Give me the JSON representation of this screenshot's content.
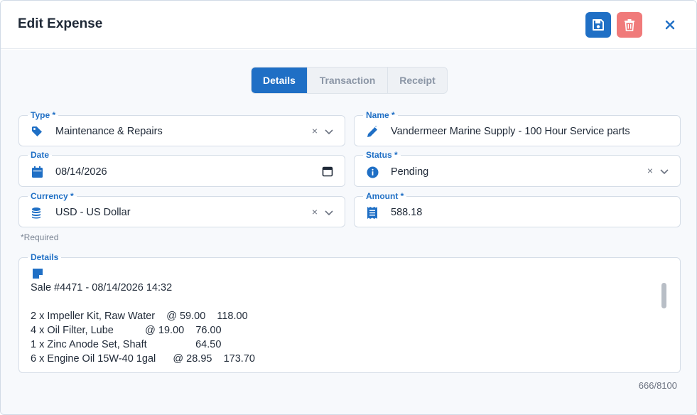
{
  "dialog": {
    "title": "Edit Expense"
  },
  "tabs": [
    {
      "label": "Details",
      "active": true
    },
    {
      "label": "Transaction",
      "active": false
    },
    {
      "label": "Receipt",
      "active": false
    }
  ],
  "fields": {
    "type": {
      "label": "Type *",
      "value": "Maintenance & Repairs",
      "icon": "tag-icon"
    },
    "name": {
      "label": "Name *",
      "value": "Vandermeer Marine Supply - 100 Hour Service parts",
      "icon": "pencil-icon"
    },
    "date": {
      "label": "Date",
      "value": "08/14/2026",
      "icon": "calendar-icon"
    },
    "status": {
      "label": "Status *",
      "value": "Pending",
      "icon": "info-icon"
    },
    "currency": {
      "label": "Currency *",
      "value": "USD - US Dollar",
      "icon": "coins-icon"
    },
    "amount": {
      "label": "Amount *",
      "value": "588.18",
      "icon": "receipt-icon"
    }
  },
  "required_note": "*Required",
  "details": {
    "label": "Details",
    "icon": "note-icon",
    "text": "Sale #4471 - 08/14/2026 14:32\n\n2 x Impeller Kit, Raw Water    @ 59.00    118.00\n4 x Oil Filter, Lube           @ 19.00    76.00\n1 x Zinc Anode Set, Shaft                 64.50\n6 x Engine Oil 15W-40 1gal      @ 28.95    173.70",
    "counter": "666/8100"
  },
  "clear_glyph": "×",
  "colors": {
    "primary": "#1f6fc5",
    "danger": "#f07a7a",
    "label": "#1f6fc5"
  }
}
